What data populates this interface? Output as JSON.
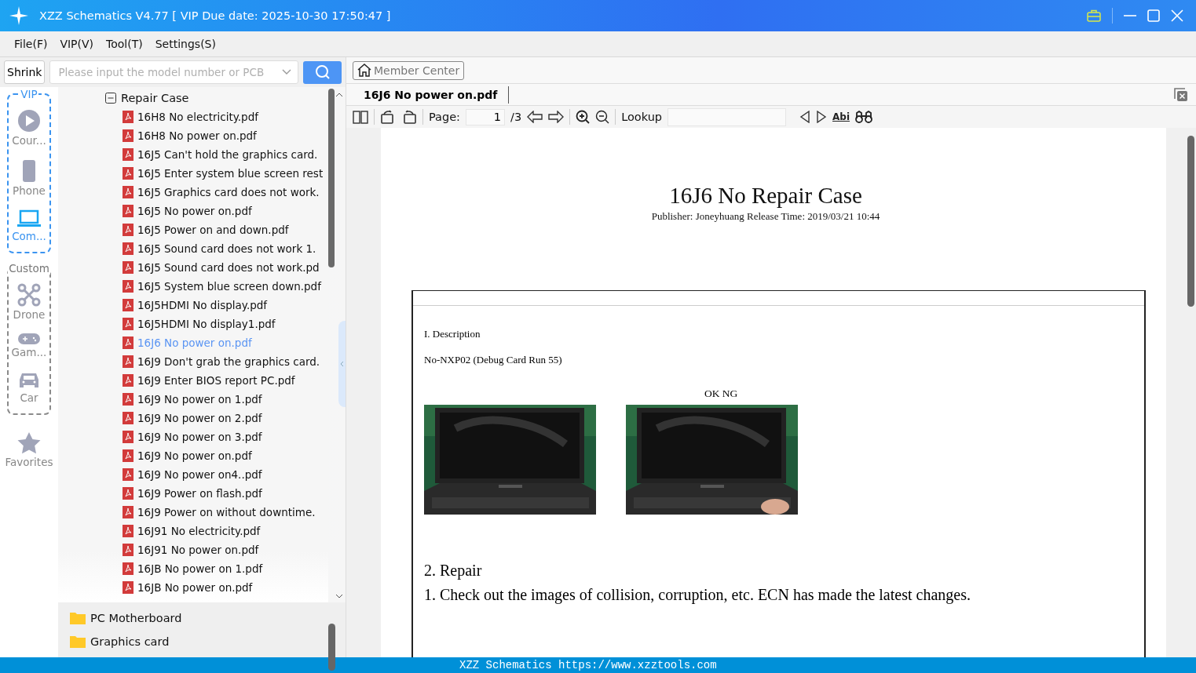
{
  "window": {
    "title": "XZZ Schematics V4.77 [ VIP Due date: 2025-10-30 17:50:47 ]"
  },
  "menu": [
    "File(F)",
    "VIP(V)",
    "Tool(T)",
    "Settings(S)"
  ],
  "search": {
    "button": "Shrink",
    "placeholder": "Please input the model number or PCB"
  },
  "categories": [
    {
      "group": "VIP",
      "items": [
        {
          "label": "Cour...",
          "kind": "play",
          "selected": false
        },
        {
          "label": "Phone",
          "kind": "phone",
          "selected": false
        },
        {
          "label": "Com...",
          "kind": "laptop",
          "selected": true
        }
      ]
    },
    {
      "group": "Custom",
      "items": [
        {
          "label": "Drone",
          "kind": "drone",
          "selected": false
        },
        {
          "label": "Gam...",
          "kind": "gamepad",
          "selected": false
        },
        {
          "label": "Car",
          "kind": "car",
          "selected": false
        }
      ]
    }
  ],
  "favorites": {
    "label": "Favorites"
  },
  "tree": {
    "label": "Repair Case",
    "expanded": true,
    "children": [
      {
        "label": "16H8 No electricity.pdf",
        "selected": false
      },
      {
        "label": "16H8 No power on.pdf",
        "selected": false
      },
      {
        "label": "16J5 Can't hold the graphics card.",
        "selected": false
      },
      {
        "label": "16J5 Enter system blue screen rest",
        "selected": false
      },
      {
        "label": "16J5 Graphics card does not work.",
        "selected": false
      },
      {
        "label": "16J5 No power on.pdf",
        "selected": false
      },
      {
        "label": "16J5 Power on and down.pdf",
        "selected": false
      },
      {
        "label": "16J5 Sound card does not work 1.",
        "selected": false
      },
      {
        "label": "16J5 Sound card does not work.pd",
        "selected": false
      },
      {
        "label": "16J5 System blue screen down.pdf",
        "selected": false
      },
      {
        "label": "16J5HDMI No display.pdf",
        "selected": false
      },
      {
        "label": "16J5HDMI No display1.pdf",
        "selected": false
      },
      {
        "label": "16J6 No power on.pdf",
        "selected": true
      },
      {
        "label": "16J9 Don't grab the graphics card.",
        "selected": false
      },
      {
        "label": "16J9 Enter BIOS report PC.pdf",
        "selected": false
      },
      {
        "label": "16J9 No power on 1.pdf",
        "selected": false
      },
      {
        "label": "16J9 No power on 2.pdf",
        "selected": false
      },
      {
        "label": "16J9 No power on 3.pdf",
        "selected": false
      },
      {
        "label": "16J9 No power on.pdf",
        "selected": false
      },
      {
        "label": "16J9 No power on4..pdf",
        "selected": false
      },
      {
        "label": "16J9 Power on flash.pdf",
        "selected": false
      },
      {
        "label": "16J9 Power on without downtime.",
        "selected": false
      },
      {
        "label": "16J91 No electricity.pdf",
        "selected": false
      },
      {
        "label": "16J91 No power on.pdf",
        "selected": false
      },
      {
        "label": "16JB No power on 1.pdf",
        "selected": false
      },
      {
        "label": "16JB No power on.pdf",
        "selected": false
      }
    ]
  },
  "folders": [
    {
      "label": "PC Motherboard"
    },
    {
      "label": "Graphics card"
    }
  ],
  "member_center": "Member Center",
  "doc_tab": {
    "label": "16J6 No power on.pdf"
  },
  "toolbar": {
    "page_label": "Page:",
    "page": "1",
    "page_total": "/3",
    "lookup_label": "Lookup",
    "abi": "Abi"
  },
  "document": {
    "title": "16J6 No Repair Case",
    "meta": "Publisher: Joneyhuang Release Time: 2019/03/21 10:44",
    "section1": "I. Description",
    "line1": "No-NXP02 (Debug Card Run 55)",
    "ok_ng": "OK NG",
    "section2": "2. Repair",
    "line2": "1. Check out the images of collision, corruption, etc. ECN has made the latest changes."
  },
  "status_bar": "XZZ Schematics https://www.xzztools.com"
}
